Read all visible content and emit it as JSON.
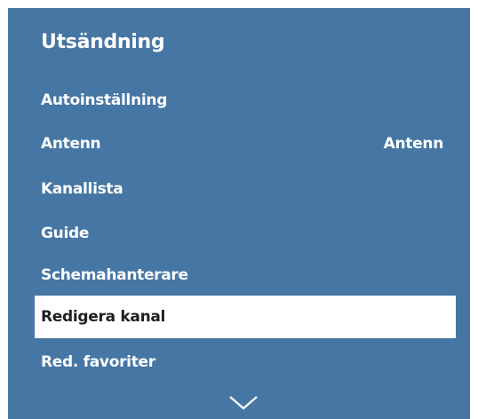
{
  "panel": {
    "title": "Utsändning",
    "background": "#4676a4",
    "selected_background": "#ffffff"
  },
  "menu": {
    "items": [
      {
        "label": "Autoinställning",
        "value": ""
      },
      {
        "label": "Antenn",
        "value": "Antenn"
      },
      {
        "label": "Kanallista",
        "value": ""
      },
      {
        "label": "Guide",
        "value": ""
      },
      {
        "label": "Schemahanterare",
        "value": ""
      },
      {
        "label": "Redigera kanal",
        "value": "",
        "selected": true
      },
      {
        "label": "Red. favoriter",
        "value": ""
      }
    ]
  },
  "scroll": {
    "icon": "chevron-down-icon"
  }
}
